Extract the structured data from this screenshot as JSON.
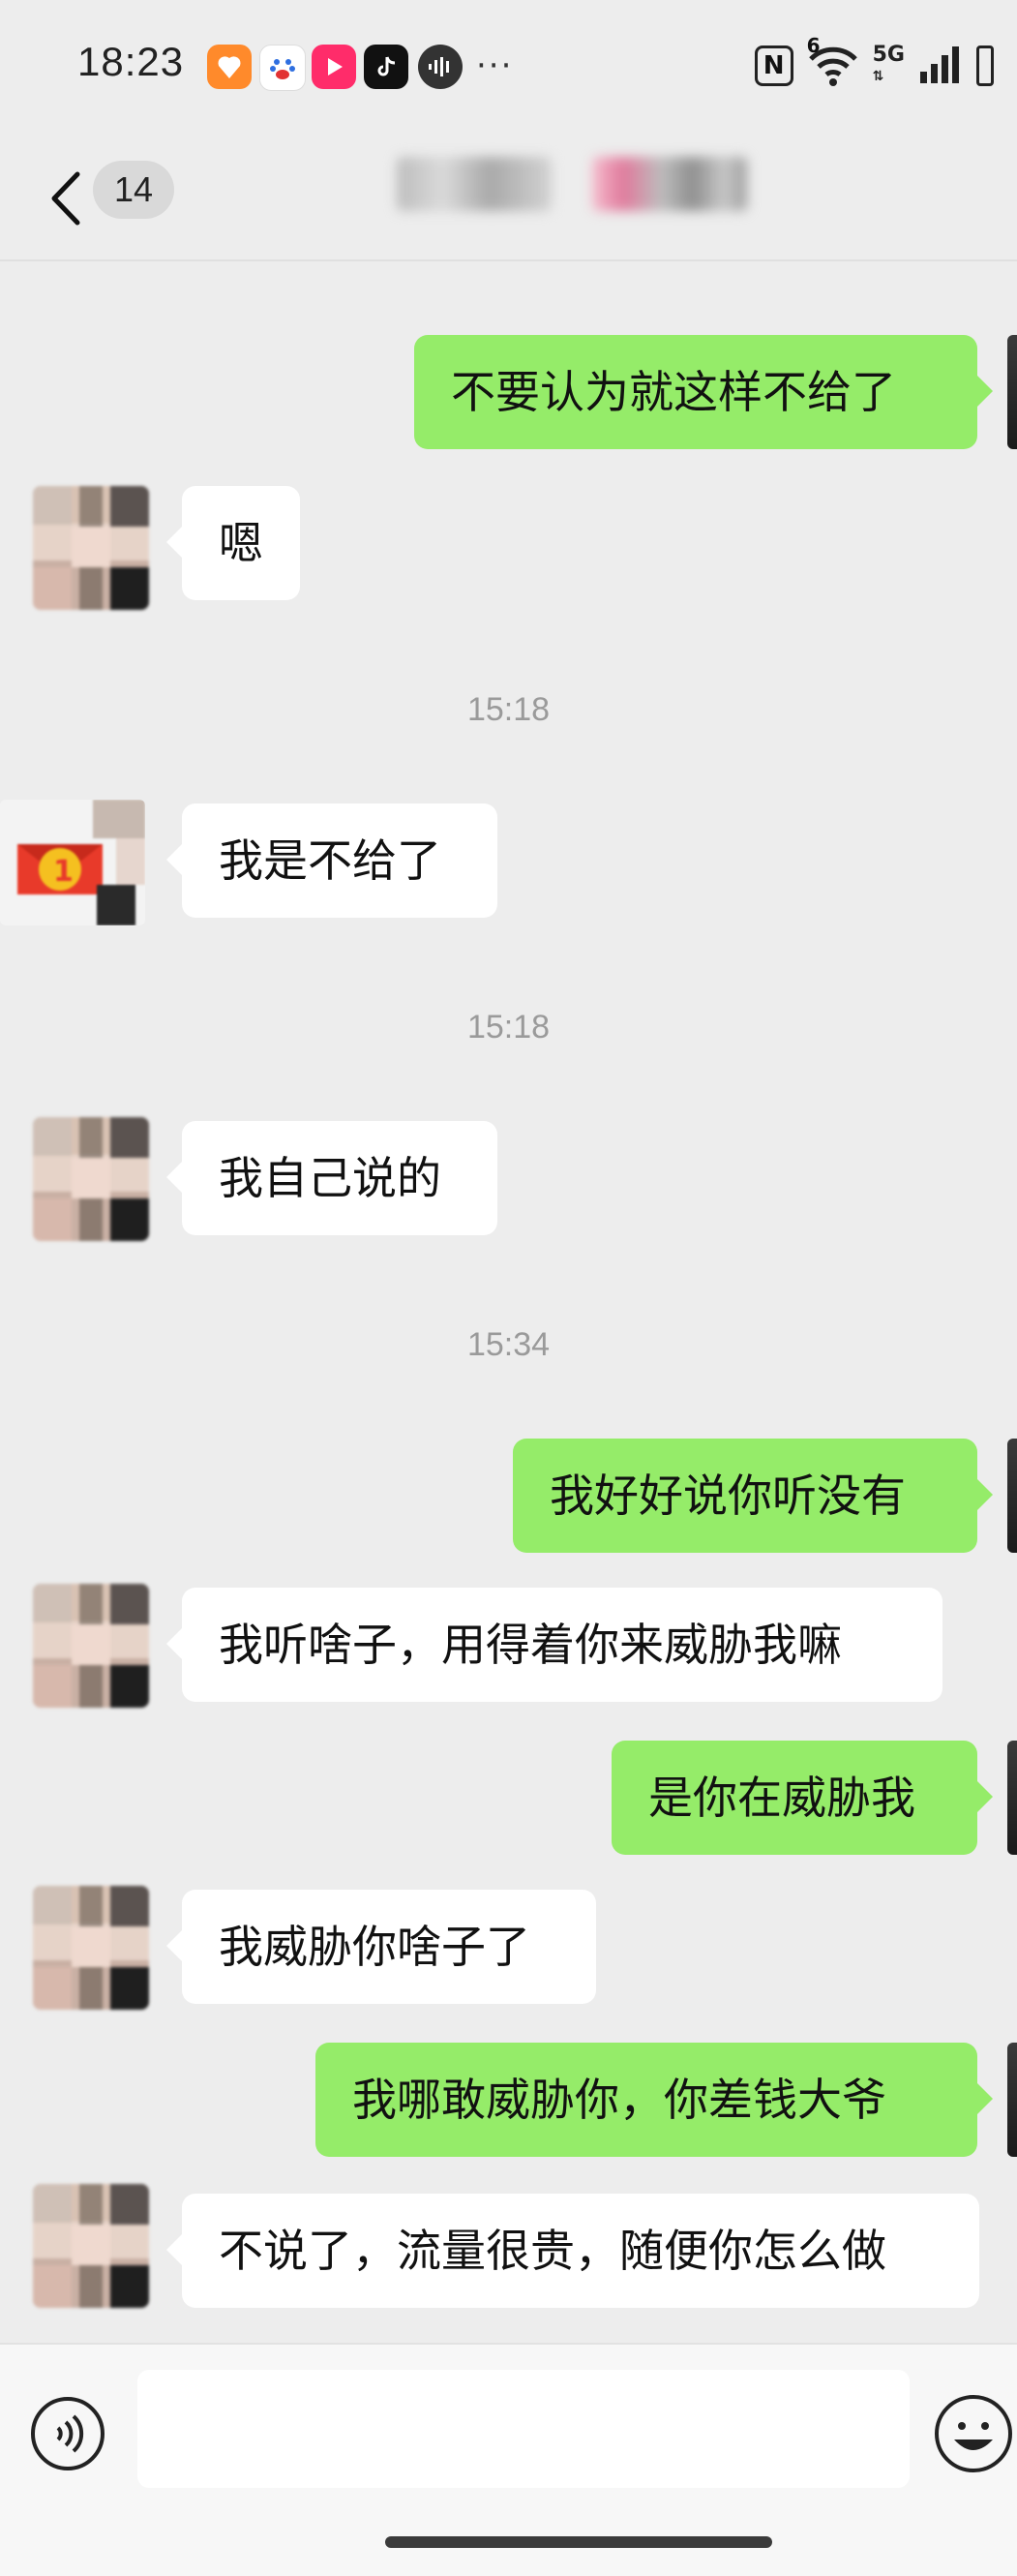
{
  "status_bar": {
    "time": "18:23",
    "app_icons": [
      "taobao-icon",
      "baidu-icon",
      "video-app-icon",
      "tiktok-icon",
      "audio-app-icon"
    ],
    "more": "···",
    "nfc": "N",
    "network_6": "6",
    "network_label": "5G",
    "battery_label": "",
    "signal_icon": "signal-icon",
    "wifi_icon": "wifi-icon"
  },
  "header": {
    "unread_count": "14",
    "title": "",
    "back_icon": "chevron-left-icon"
  },
  "messages": [
    {
      "side": "out",
      "text": "不要认为就这样不给了"
    },
    {
      "side": "in",
      "text": "嗯"
    },
    {
      "side": "time",
      "text": "15:18"
    },
    {
      "side": "in",
      "text": "我是不给了"
    },
    {
      "side": "time",
      "text": "15:18"
    },
    {
      "side": "in",
      "text": "我自己说的"
    },
    {
      "side": "time",
      "text": "15:34"
    },
    {
      "side": "out",
      "text": "我好好说你听没有"
    },
    {
      "side": "in",
      "text": "我听啥子，用得着你来威胁我嘛"
    },
    {
      "side": "out",
      "text": "是你在威胁我"
    },
    {
      "side": "in",
      "text": "我威胁你啥子了"
    },
    {
      "side": "out",
      "text": "我哪敢威胁你，你差钱大爷"
    },
    {
      "side": "in",
      "text": "不说了，流量很贵，随便你怎么做"
    }
  ],
  "input": {
    "value": "",
    "voice_icon": "voice-icon",
    "emoji_icon": "emoji-icon"
  },
  "colors": {
    "background": "#ededed",
    "outgoing_bubble": "#95ec69",
    "incoming_bubble": "#ffffff",
    "timestamp_text": "#9a9a9a"
  }
}
